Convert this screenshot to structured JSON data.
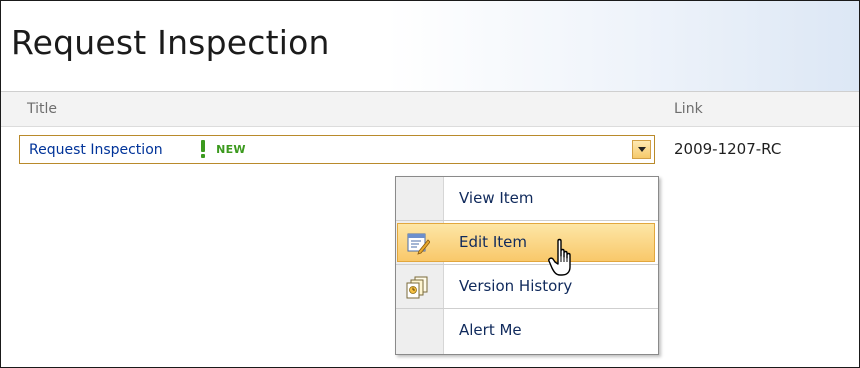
{
  "page": {
    "title": "Request Inspection"
  },
  "list": {
    "columns": [
      "Title",
      "Link"
    ],
    "rows": [
      {
        "title": "Request Inspection",
        "new_badge": "NEW",
        "link": "2009-1207-RC"
      }
    ]
  },
  "context_menu": {
    "items": [
      {
        "label": "View Item",
        "icon": ""
      },
      {
        "label": "Edit Item",
        "icon": "edit-document-icon",
        "highlighted": true
      },
      {
        "label": "Version History",
        "icon": "version-history-icon"
      },
      {
        "label": "Alert Me",
        "icon": ""
      }
    ]
  },
  "colors": {
    "title_link": "#003399",
    "new_badge": "#3c9a1e",
    "menu_highlight": "#f9c86a",
    "selected_border": "#b98a2b"
  },
  "icons": [
    "chevron-down-icon",
    "edit-document-icon",
    "version-history-icon",
    "hand-pointer-cursor-icon",
    "exclamation-icon"
  ]
}
